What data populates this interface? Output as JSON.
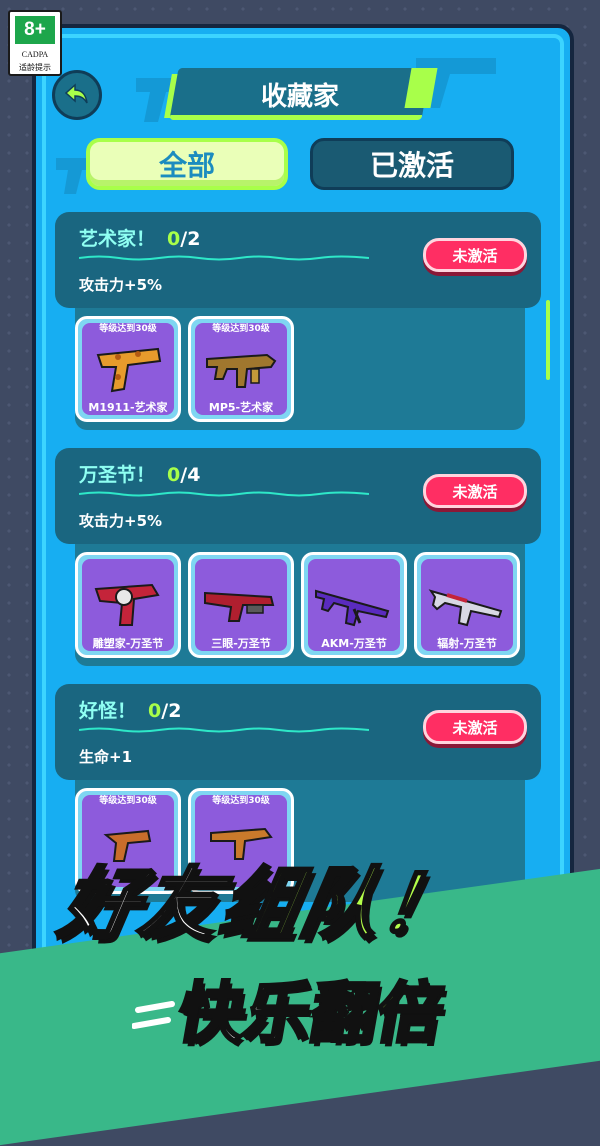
{
  "age_badge": {
    "rating": "8+",
    "org": "CADPA",
    "tip": "适龄提示"
  },
  "header": {
    "title": "收藏家",
    "back_icon": "back-arrow-icon"
  },
  "tabs": [
    {
      "label": "全部",
      "selected": true
    },
    {
      "label": "已激活",
      "selected": false
    }
  ],
  "sets": [
    {
      "name": "艺术家！",
      "collected": "0",
      "total": "2",
      "bonus": "攻击力+5%",
      "status": "未激活",
      "items": [
        {
          "level": "等级达到30级",
          "name": "M1911-艺术家"
        },
        {
          "level": "等级达到30级",
          "name": "MP5-艺术家"
        }
      ]
    },
    {
      "name": "万圣节！",
      "collected": "0",
      "total": "4",
      "bonus": "攻击力+5%",
      "status": "未激活",
      "items": [
        {
          "level": "",
          "name": "雕塑家-万圣节"
        },
        {
          "level": "",
          "name": "三眼-万圣节"
        },
        {
          "level": "",
          "name": "AKM-万圣节"
        },
        {
          "level": "",
          "name": "辐射-万圣节"
        }
      ]
    },
    {
      "name": "好怪！",
      "collected": "0",
      "total": "2",
      "bonus": "生命+1",
      "status": "未激活",
      "items": [
        {
          "level": "等级达到30级",
          "name": ""
        },
        {
          "level": "等级达到30级",
          "name": ""
        }
      ]
    }
  ],
  "promo": {
    "line1_a": "好友",
    "line1_b": "组队！",
    "line2_a": "快乐",
    "line2_b": "翻倍"
  },
  "colors": {
    "accent": "#a8ff4a",
    "panel": "#17aef2",
    "status": "#ff2e63"
  }
}
